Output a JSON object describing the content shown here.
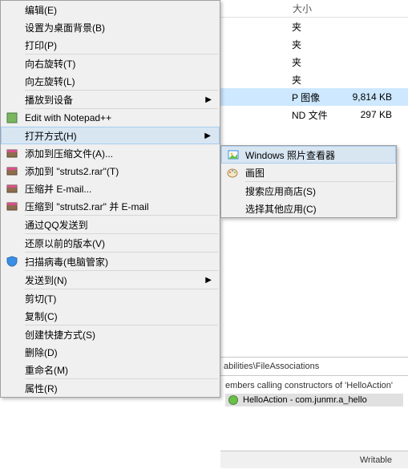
{
  "explorer": {
    "column_size": "大小",
    "rows": [
      {
        "type": "夹",
        "size": ""
      },
      {
        "type": "夹",
        "size": ""
      },
      {
        "type": "夹",
        "size": ""
      },
      {
        "type": "夹",
        "size": ""
      },
      {
        "type": "P 图像",
        "size": "9,814 KB"
      },
      {
        "type": "ND 文件",
        "size": "297 KB"
      }
    ]
  },
  "menu": {
    "edit": "编辑(E)",
    "set_background": "设置为桌面背景(B)",
    "print": "打印(P)",
    "rotate_right": "向右旋转(T)",
    "rotate_left": "向左旋转(L)",
    "cast": "播放到设备",
    "notepadpp": "Edit with Notepad++",
    "open_with": "打开方式(H)",
    "add_archive": "添加到压缩文件(A)...",
    "add_struts": "添加到 \"struts2.rar\"(T)",
    "compress_email": "压缩并 E-mail...",
    "compress_struts_email": "压缩到 \"struts2.rar\" 并 E-mail",
    "qq_send": "通过QQ发送到",
    "restore_prev": "还原以前的版本(V)",
    "scan_virus": "扫描病毒(电脑管家)",
    "send_to": "发送到(N)",
    "cut": "剪切(T)",
    "copy": "复制(C)",
    "create_shortcut": "创建快捷方式(S)",
    "delete": "删除(D)",
    "rename": "重命名(M)",
    "properties": "属性(R)"
  },
  "submenu": {
    "photo_viewer": "Windows 照片查看器",
    "paint": "画图",
    "search_store": "搜索应用商店(S)",
    "choose_other": "选择其他应用(C)"
  },
  "ide": {
    "tab": "abilities\\FileAssociations",
    "desc": "embers calling constructors of 'HelloAction'",
    "result": "HelloAction - com.junmr.a_hello",
    "status": "Writable"
  }
}
